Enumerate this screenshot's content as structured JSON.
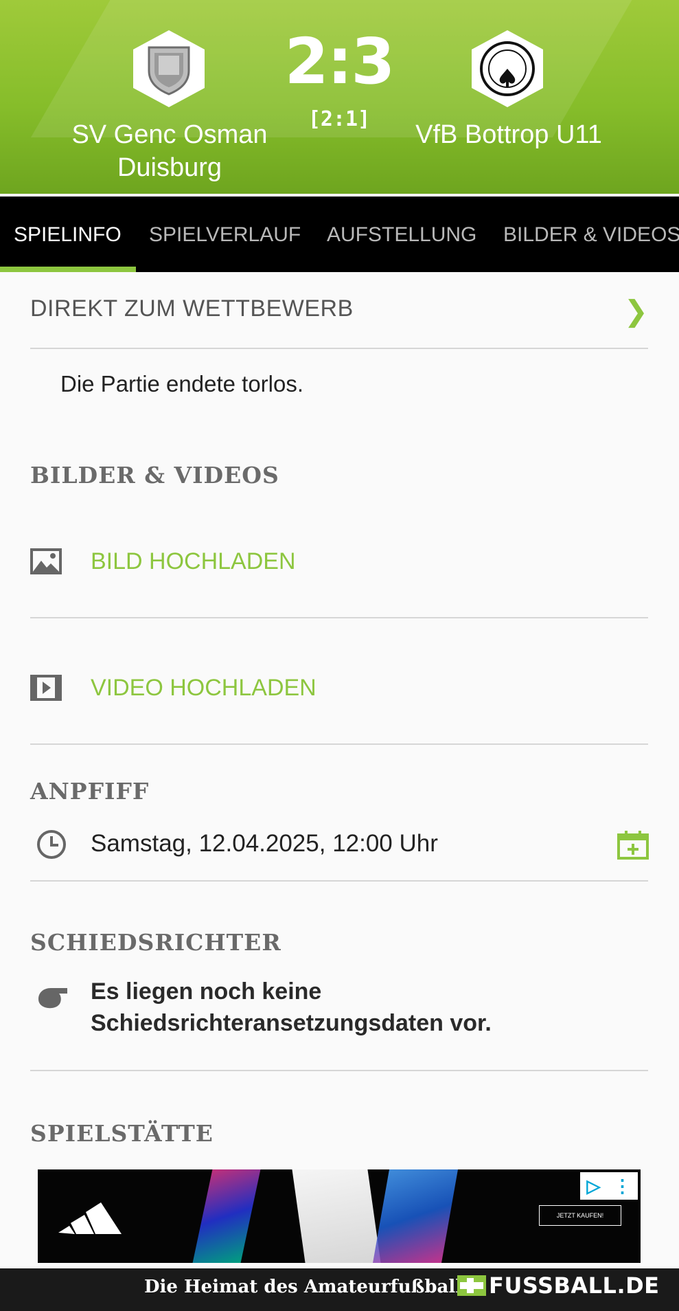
{
  "match": {
    "home_team": "SV Genc Osman Duisburg",
    "away_team": "VfB Bottrop U11",
    "score": "2:3",
    "halftime": "[2:1]"
  },
  "tabs": [
    "SPIELINFO",
    "SPIELVERLAUF",
    "AUFSTELLUNG",
    "BILDER & VIDEOS"
  ],
  "active_tab": "SPIELINFO",
  "competition_link": {
    "label": "DIREKT ZUM WETTBEWERB",
    "chevron": "❯"
  },
  "report_text": "Die Partie endete torlos.",
  "media": {
    "heading": "BILDER & VIDEOS",
    "upload_image": "BILD HOCHLADEN",
    "upload_video": "VIDEO HOCHLADEN"
  },
  "kickoff": {
    "heading": "ANPFIFF",
    "datetime": "Samstag, 12.04.2025, 12:00 Uhr"
  },
  "referee": {
    "heading": "SCHIEDSRICHTER",
    "text": "Es liegen noch keine Schiedsrichteransetzungsdaten vor."
  },
  "venue": {
    "heading": "SPIELSTÄTTE"
  },
  "ad": {
    "cta": "JETZT KAUFEN!"
  },
  "footer": {
    "tagline": "Die Heimat des Amateurfußballs",
    "brand": "FUSSBALL.DE"
  },
  "colors": {
    "accent": "#8dc63f",
    "header_green": "#86bd2a",
    "tab_bar": "#000000"
  }
}
